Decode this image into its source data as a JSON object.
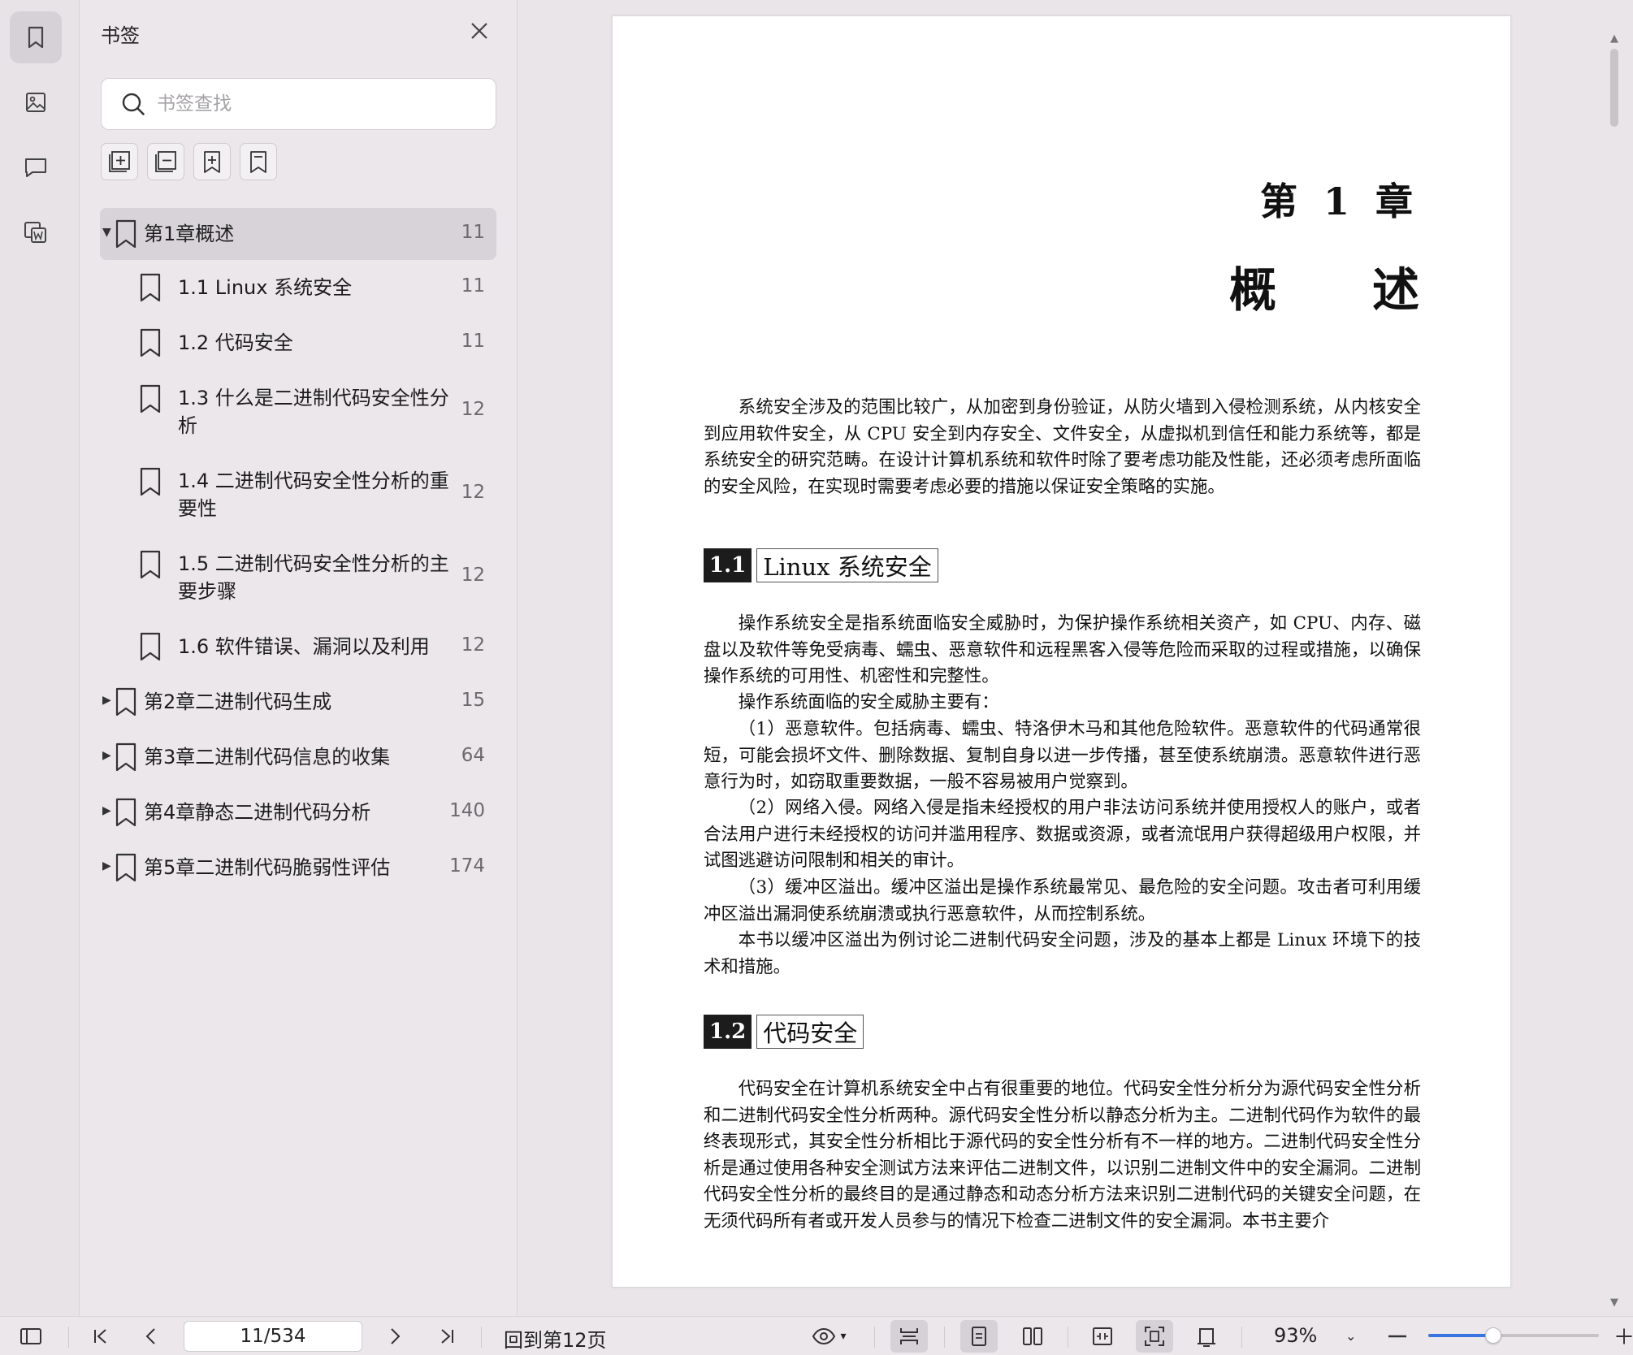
{
  "sidebar": {
    "title": "书签",
    "search_placeholder": "书签查找",
    "items": [
      {
        "label": "第1章概述",
        "page": "11",
        "level": 0,
        "expanded": true,
        "selected": true
      },
      {
        "label": "1.1 Linux 系统安全",
        "page": "11",
        "level": 1
      },
      {
        "label": "1.2 代码安全",
        "page": "11",
        "level": 1
      },
      {
        "label_line1": "1.3 什么是二进制代码安全性分",
        "label_line2": "析",
        "page": "12",
        "level": 1
      },
      {
        "label_line1": "1.4 二进制代码安全性分析的重",
        "label_line2": "要性",
        "page": "12",
        "level": 1
      },
      {
        "label_line1": "1.5 二进制代码安全性分析的主",
        "label_line2": "要步骤",
        "page": "12",
        "level": 1
      },
      {
        "label": "1.6 软件错误、漏洞以及利用",
        "page": "12",
        "level": 1
      },
      {
        "label": "第2章二进制代码生成",
        "page": "15",
        "level": 0,
        "expanded": false
      },
      {
        "label": "第3章二进制代码信息的收集",
        "page": "64",
        "level": 0,
        "expanded": false
      },
      {
        "label": "第4章静态二进制代码分析",
        "page": "140",
        "level": 0,
        "expanded": false
      },
      {
        "label": "第5章二进制代码脆弱性评估",
        "page": "174",
        "level": 0,
        "expanded": false
      }
    ]
  },
  "document": {
    "chapter_number": "第 1 章",
    "chapter_title_a": "概",
    "chapter_title_b": "述",
    "intro": "系统安全涉及的范围比较广，从加密到身份验证，从防火墙到入侵检测系统，从内核安全到应用软件安全，从 CPU 安全到内存安全、文件安全，从虚拟机到信任和能力系统等，都是系统安全的研究范畴。在设计计算机系统和软件时除了要考虑功能及性能，还必须考虑所面临的安全风险，在实现时需要考虑必要的措施以保证安全策略的实施。",
    "section1_num": "1.1",
    "section1_title": "Linux 系统安全",
    "s1_p1": "操作系统安全是指系统面临安全威胁时，为保护操作系统相关资产，如 CPU、内存、磁盘以及软件等免受病毒、蠕虫、恶意软件和远程黑客入侵等危险而采取的过程或措施，以确保操作系统的可用性、机密性和完整性。",
    "s1_p2": "操作系统面临的安全威胁主要有：",
    "s1_p3": "（1）恶意软件。包括病毒、蠕虫、特洛伊木马和其他危险软件。恶意软件的代码通常很短，可能会损坏文件、删除数据、复制自身以进一步传播，甚至使系统崩溃。恶意软件进行恶意行为时，如窃取重要数据，一般不容易被用户觉察到。",
    "s1_p4": "（2）网络入侵。网络入侵是指未经授权的用户非法访问系统并使用授权人的账户，或者合法用户进行未经授权的访问并滥用程序、数据或资源，或者流氓用户获得超级用户权限，并试图逃避访问限制和相关的审计。",
    "s1_p5": "（3）缓冲区溢出。缓冲区溢出是操作系统最常见、最危险的安全问题。攻击者可利用缓冲区溢出漏洞使系统崩溃或执行恶意软件，从而控制系统。",
    "s1_p6": "本书以缓冲区溢出为例讨论二进制代码安全问题，涉及的基本上都是 Linux 环境下的技术和措施。",
    "section2_num": "1.2",
    "section2_title": "代码安全",
    "s2_p1": "代码安全在计算机系统安全中占有很重要的地位。代码安全性分析分为源代码安全性分析和二进制代码安全性分析两种。源代码安全性分析以静态分析为主。二进制代码作为软件的最终表现形式，其安全性分析相比于源代码的安全性分析有不一样的地方。二进制代码安全性分析是通过使用各种安全测试方法来评估二进制文件，以识别二进制文件中的安全漏洞。二进制代码安全性分析的最终目的是通过静态和动态分析方法来识别二进制代码的关键安全问题，在无须代码所有者或开发人员参与的情况下检查二进制文件的安全漏洞。本书主要介"
  },
  "bottombar": {
    "page_indicator": "11/534",
    "back_link": "回到第12页",
    "zoom": "93%",
    "zoom_fraction": 0.38
  },
  "colors": {
    "accent": "#3a74e0",
    "selected_row": "#d7d3d8",
    "background": "#e9e5e9"
  }
}
